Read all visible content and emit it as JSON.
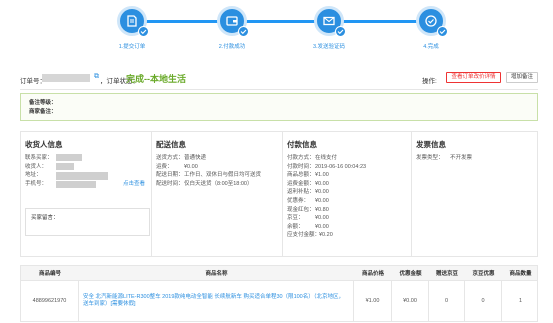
{
  "steps": [
    {
      "label": "1.提交订单",
      "icon": "document-icon"
    },
    {
      "label": "2.付款成功",
      "icon": "wallet-icon"
    },
    {
      "label": "3.发送验证码",
      "icon": "envelope-icon"
    },
    {
      "label": "4.完成",
      "icon": "check-circle-icon"
    }
  ],
  "order": {
    "number_label": "订单号：",
    "status_label": "，订单状态：",
    "status_value": "完成--本地生活",
    "ops_label": "操作:",
    "view_detail_btn": "查看订单改价详情",
    "add_remark_btn": "增加备注"
  },
  "remark": {
    "line1": "备注等级：",
    "line2": "商家备注："
  },
  "receiver": {
    "title": "收货人信息",
    "rows": [
      {
        "k": "联系买家：",
        "v": ""
      },
      {
        "k": "收货人：",
        "v": ""
      },
      {
        "k": "地址：",
        "v": ""
      },
      {
        "k": "手机号：",
        "v": ""
      }
    ],
    "link": "点击查看",
    "msg_label": "买家留言："
  },
  "delivery": {
    "title": "配送信息",
    "rows": [
      {
        "k": "送货方式：",
        "v": "普通快递"
      },
      {
        "k": "运费：",
        "v": "¥0.00"
      },
      {
        "k": "配送日期：",
        "v": "工作日、双休日与假日均可送货"
      },
      {
        "k": "配送时间：",
        "v": "仅白天送货（8:00至18:00）"
      }
    ]
  },
  "payment": {
    "title": "付款信息",
    "rows": [
      {
        "k": "付款方式：",
        "v": "在线支付"
      },
      {
        "k": "付款时间：",
        "v": "2019-06-16 00:04:23"
      },
      {
        "k": "商品总额：",
        "v": "¥1.00"
      },
      {
        "k": "运费金额：",
        "v": "¥0.00"
      },
      {
        "k": "返利补贴：",
        "v": "¥0.00"
      },
      {
        "k": "优惠券：",
        "v": "¥0.00"
      },
      {
        "k": "现金红包：",
        "v": "¥0.80"
      },
      {
        "k": "京豆：",
        "v": "¥0.00"
      },
      {
        "k": "余额：",
        "v": "¥0.00"
      },
      {
        "k": "应支付金额：",
        "v": "¥0.20"
      }
    ]
  },
  "invoice": {
    "title": "发票信息",
    "rows": [
      {
        "k": "发票类型：",
        "v": "不开发票"
      }
    ]
  },
  "table": {
    "headers": [
      "商品编号",
      "商品名称",
      "商品价格",
      "优惠金额",
      "赠送京豆",
      "京豆优惠",
      "商品数量"
    ],
    "row": {
      "id": "48899621970",
      "name": "安全 北汽新能源LITE-R300整车 2019款纯电动全智能 长续航新车 购买适合单程30（限100名）（北京地区，送车到家）[需要休假]",
      "price": "¥1.00",
      "discount": "¥0.00",
      "beans": "0",
      "bean_discount": "0",
      "qty": "1"
    }
  },
  "colors": {
    "accent": "#2b8fe0",
    "status": "#6aaa2a",
    "danger": "#ee3333"
  }
}
